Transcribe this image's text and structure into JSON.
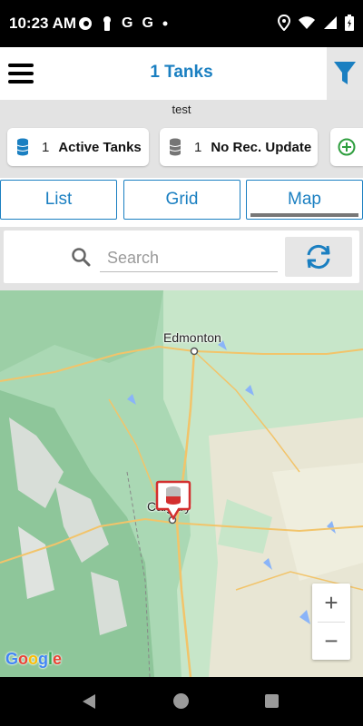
{
  "status_bar": {
    "time": "10:23 AM",
    "left_icons": [
      "notification-icon",
      "keyhole-icon",
      "google-icon",
      "google-icon",
      "dot-icon"
    ],
    "google_letter": "G",
    "right_icons": [
      "location-icon",
      "wifi-icon",
      "signal-icon",
      "battery-icon"
    ]
  },
  "header": {
    "title": "1 Tanks",
    "menu_icon": "hamburger-menu-icon",
    "filter_icon": "filter-icon"
  },
  "subtitle": "test",
  "stats": [
    {
      "count": "1",
      "label": "Active Tanks",
      "icon": "database-icon",
      "icon_color": "#1a7fc1"
    },
    {
      "count": "1",
      "label": "No Rec. Update",
      "icon": "database-icon",
      "icon_color": "#757575"
    }
  ],
  "add_icon": "add-circle-icon",
  "view_tabs": [
    {
      "label": "List",
      "selected": false
    },
    {
      "label": "Grid",
      "selected": false
    },
    {
      "label": "Map",
      "selected": true
    }
  ],
  "search": {
    "placeholder": "Search",
    "value": ""
  },
  "refresh_icon": "refresh-icon",
  "map": {
    "cities": [
      "Edmonton",
      "Calgary"
    ],
    "marker_icon": "tank-marker-icon",
    "zoom_in": "+",
    "zoom_out": "−",
    "attribution": "Google"
  },
  "colors": {
    "accent": "#1a7fc1",
    "add_green": "#2e9e3e",
    "marker_red": "#d32f2f"
  }
}
